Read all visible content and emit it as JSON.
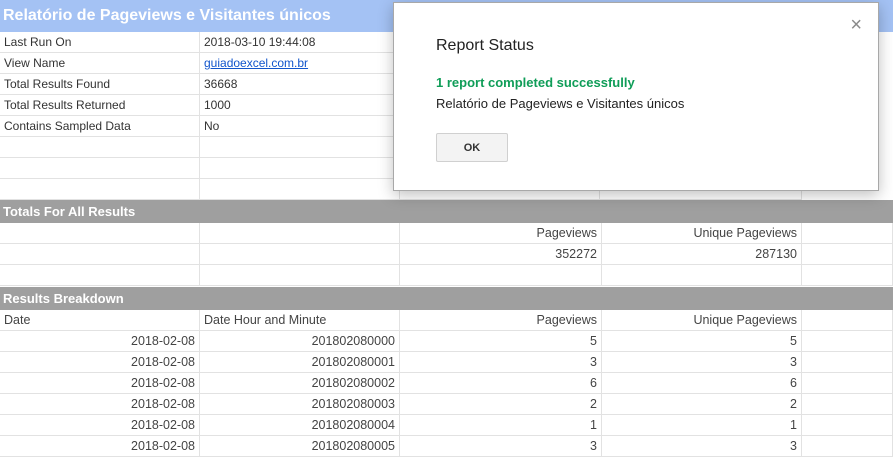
{
  "title": "Relatório de Pageviews e Visitantes únicos",
  "meta": [
    {
      "label": "Last Run On",
      "value": "2018-03-10 19:44:08"
    },
    {
      "label": "View Name",
      "value": "guiadoexcel.com.br"
    },
    {
      "label": "Total Results Found",
      "value": "36668"
    },
    {
      "label": "Total Results Returned",
      "value": "1000"
    },
    {
      "label": "Contains Sampled Data",
      "value": "No"
    }
  ],
  "totals": {
    "band_label": "Totals For All Results",
    "headers": [
      "Pageviews",
      "Unique Pageviews"
    ],
    "values": [
      "352272",
      "287130"
    ]
  },
  "breakdown": {
    "band_label": "Results Breakdown",
    "headers": [
      "Date",
      "Date Hour and Minute",
      "Pageviews",
      "Unique Pageviews"
    ],
    "rows": [
      [
        "2018-02-08",
        "201802080000",
        "5",
        "5"
      ],
      [
        "2018-02-08",
        "201802080001",
        "3",
        "3"
      ],
      [
        "2018-02-08",
        "201802080002",
        "6",
        "6"
      ],
      [
        "2018-02-08",
        "201802080003",
        "2",
        "2"
      ],
      [
        "2018-02-08",
        "201802080004",
        "1",
        "1"
      ],
      [
        "2018-02-08",
        "201802080005",
        "3",
        "3"
      ]
    ]
  },
  "dialog": {
    "title": "Report Status",
    "close": "×",
    "success": "1 report completed successfully",
    "detail": "Relatório de Pageviews e Visitantes únicos",
    "ok_label": "OK"
  },
  "colors": {
    "title_band": "#a4c2f4",
    "section_band": "#9f9f9f",
    "success_text": "#0f9d58",
    "link": "#1155cc"
  }
}
